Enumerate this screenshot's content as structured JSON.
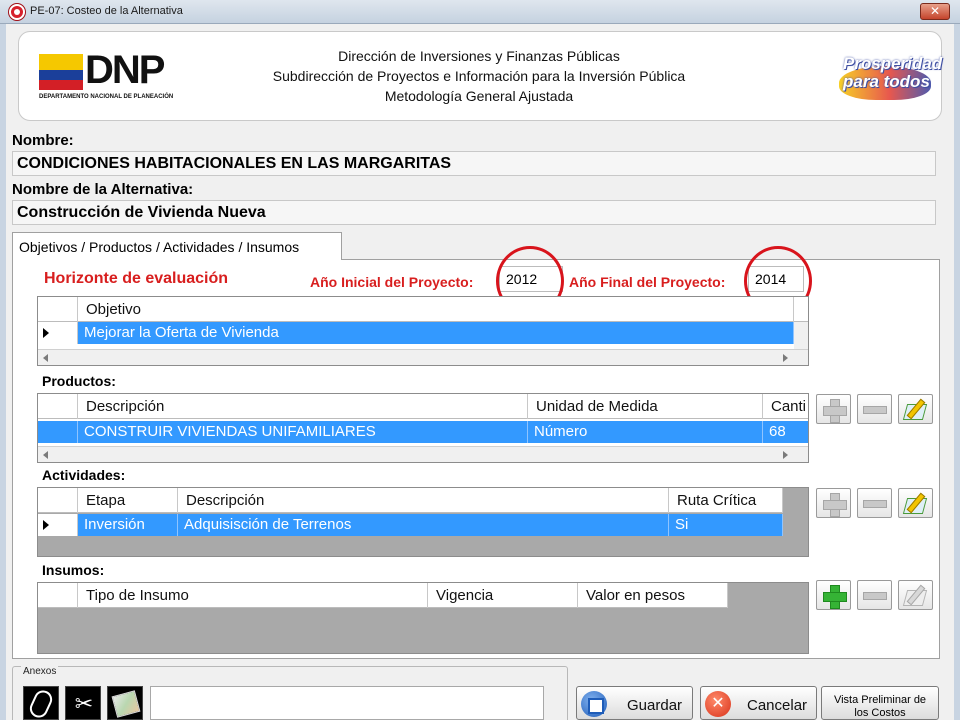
{
  "window": {
    "title": "PE-07: Costeo de la Alternativa",
    "close_symbol": "✕"
  },
  "header": {
    "logo_text": "DNP",
    "logo_subtext": "DEPARTAMENTO NACIONAL DE PLANEACIÓN",
    "line1": "Dirección de Inversiones y Finanzas Públicas",
    "line2": "Subdirección de Proyectos e Información para la Inversión Pública",
    "line3": "Metodología General Ajustada",
    "slogan_line1": "Prosperidad",
    "slogan_line2": "para todos"
  },
  "project": {
    "name_label": "Nombre:",
    "name_value": "CONDICIONES HABITACIONALES EN LAS MARGARITAS",
    "alt_label": "Nombre de la Alternativa:",
    "alt_value": "Construcción de Vivienda Nueva"
  },
  "tab": {
    "label": "Objetivos / Productos / Actividades / Insumos"
  },
  "horizon": {
    "title": "Horizonte de evaluación",
    "start_label": "Año Inicial del Proyecto:",
    "start_value": "2012",
    "end_label": "Año Final del Proyecto:",
    "end_value": "2014"
  },
  "objectives": {
    "columns": [
      "Objetivo"
    ],
    "rows": [
      [
        "Mejorar la Oferta de Vivienda"
      ]
    ]
  },
  "products": {
    "label": "Productos:",
    "columns": [
      "Descripción",
      "Unidad de Medida",
      "Canti"
    ],
    "rows": [
      [
        "CONSTRUIR VIVIENDAS UNIFAMILIARES",
        "Número",
        "68"
      ]
    ]
  },
  "activities": {
    "label": "Actividades:",
    "columns": [
      "Etapa",
      "Descripción",
      "Ruta Crítica"
    ],
    "rows": [
      [
        "Inversión",
        "Adquisisción de Terrenos",
        "Si"
      ]
    ]
  },
  "inputs": {
    "label": "Insumos:",
    "columns": [
      "Tipo de Insumo",
      "Vigencia",
      "Valor en pesos"
    ]
  },
  "annexes": {
    "label": "Anexos",
    "scissors_glyph": "✂"
  },
  "actions": {
    "save_label": "Guardar",
    "cancel_label": "Cancelar",
    "cancel_glyph": "✕",
    "preview_line1": "Vista Preliminar de",
    "preview_line2": "los Costos"
  },
  "colors": {
    "accent_red": "#d81e1e",
    "selection_blue": "#3399ff",
    "add_green": "#35b335"
  }
}
